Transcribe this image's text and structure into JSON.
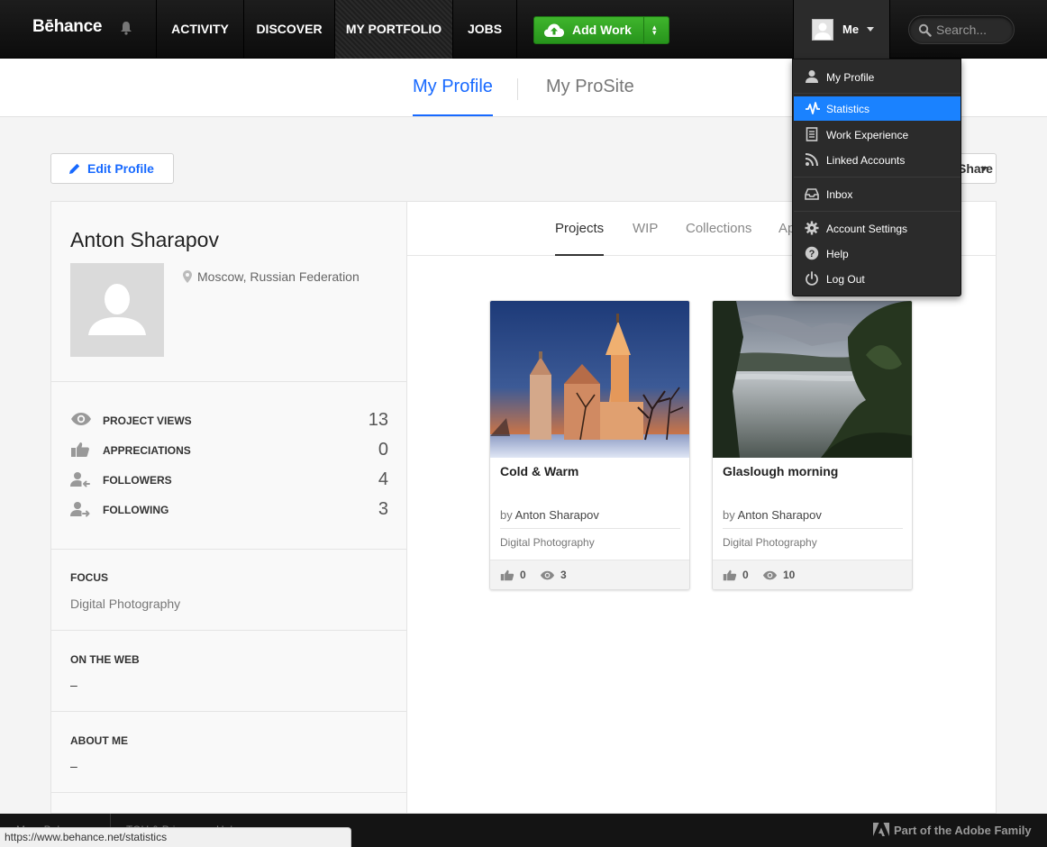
{
  "brand": {
    "logo": "Bēhance"
  },
  "nav": {
    "items": [
      "ACTIVITY",
      "DISCOVER",
      "MY PORTFOLIO",
      "JOBS"
    ],
    "active": "MY PORTFOLIO",
    "add_work_label": "Add Work",
    "me_label": "Me",
    "search_placeholder": "Search..."
  },
  "subnav": {
    "tabs": [
      "My Profile",
      "My ProSite"
    ],
    "active": "My Profile"
  },
  "actions": {
    "edit_profile": "Edit Profile",
    "share_label": "Share"
  },
  "profile": {
    "name": "Anton Sharapov",
    "location": "Moscow, Russian Federation",
    "stats": [
      {
        "icon": "eye-icon",
        "label": "PROJECT VIEWS",
        "value": "13"
      },
      {
        "icon": "thumbs-up-icon",
        "label": "APPRECIATIONS",
        "value": "0"
      },
      {
        "icon": "followers-icon",
        "label": "FOLLOWERS",
        "value": "4"
      },
      {
        "icon": "following-icon",
        "label": "FOLLOWING",
        "value": "3"
      }
    ],
    "focus_title": "FOCUS",
    "focus_value": "Digital Photography",
    "web_title": "ON THE WEB",
    "web_value": "–",
    "about_title": "ABOUT ME",
    "about_value": "–"
  },
  "portfolio_tabs": {
    "tabs": [
      "Projects",
      "WIP",
      "Collections",
      "Ap"
    ],
    "active": "Projects"
  },
  "projects": [
    {
      "title": "Cold & Warm",
      "by_prefix": "by",
      "author": "Anton Sharapov",
      "field": "Digital Photography",
      "appreciations": "0",
      "views": "3"
    },
    {
      "title": "Glaslough morning",
      "by_prefix": "by",
      "author": "Anton Sharapov",
      "field": "Digital Photography",
      "appreciations": "0",
      "views": "10"
    }
  ],
  "dropdown": {
    "items": [
      {
        "icon": "user-icon",
        "label": "My Profile"
      },
      {
        "icon": "pulse-icon",
        "label": "Statistics",
        "highlighted": true
      },
      {
        "icon": "document-icon",
        "label": "Work Experience"
      },
      {
        "icon": "rss-icon",
        "label": "Linked Accounts"
      },
      {
        "icon": "inbox-icon",
        "label": "Inbox"
      },
      {
        "icon": "gear-icon",
        "label": "Account Settings"
      },
      {
        "icon": "help-icon",
        "label": "Help"
      },
      {
        "icon": "power-icon",
        "label": "Log Out"
      }
    ]
  },
  "footer": {
    "links": [
      "More Behance",
      "TOU & Privacy",
      "Help"
    ],
    "adobe": "Part of the Adobe Family"
  },
  "statusbar": {
    "url": "https://www.behance.net/statistics"
  },
  "colors": {
    "accent": "#1769ff",
    "highlight": "#1a82ff",
    "add_work": "#2fa321",
    "nav_bg": "#141414"
  }
}
